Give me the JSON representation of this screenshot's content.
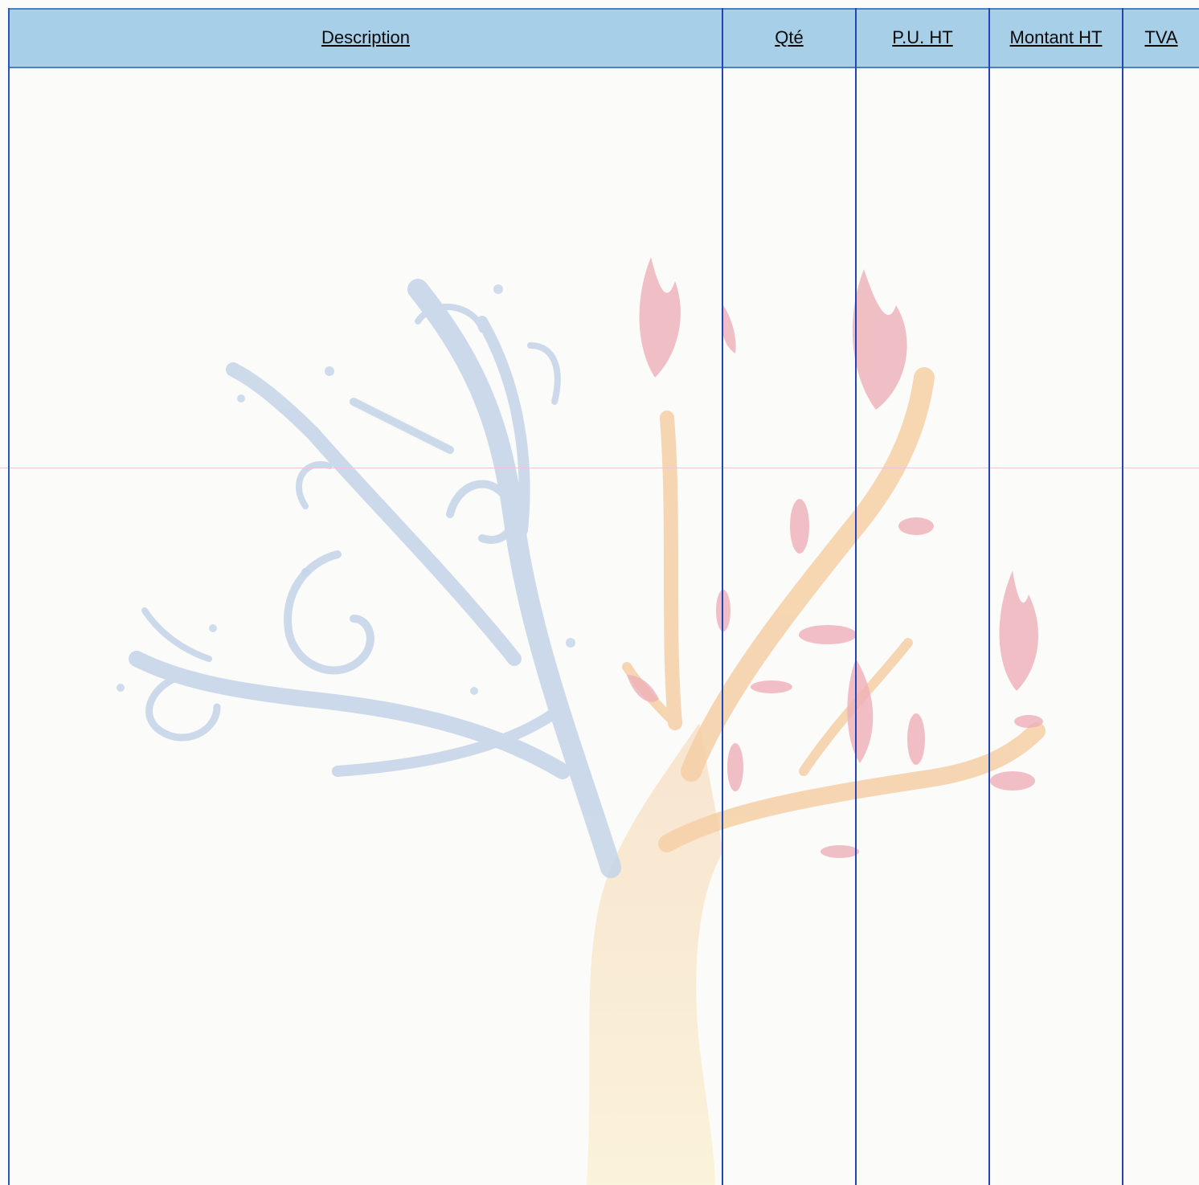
{
  "table": {
    "columns": [
      {
        "key": "description",
        "label": "Description"
      },
      {
        "key": "qty",
        "label": "Qté"
      },
      {
        "key": "unit_price",
        "label": "P.U. HT"
      },
      {
        "key": "amount",
        "label": "Montant HT"
      },
      {
        "key": "vat",
        "label": "TVA"
      }
    ],
    "rows": []
  },
  "colors": {
    "header_bg": "#a8cfe8",
    "rule": "#2446b3",
    "watermark_blue": "#b9cde4",
    "watermark_orange": "#f4c79a",
    "watermark_red": "#e9a3ae",
    "watermark_yellow": "#f9f1cf"
  },
  "watermark": {
    "icon": "tree-watermark-icon"
  }
}
